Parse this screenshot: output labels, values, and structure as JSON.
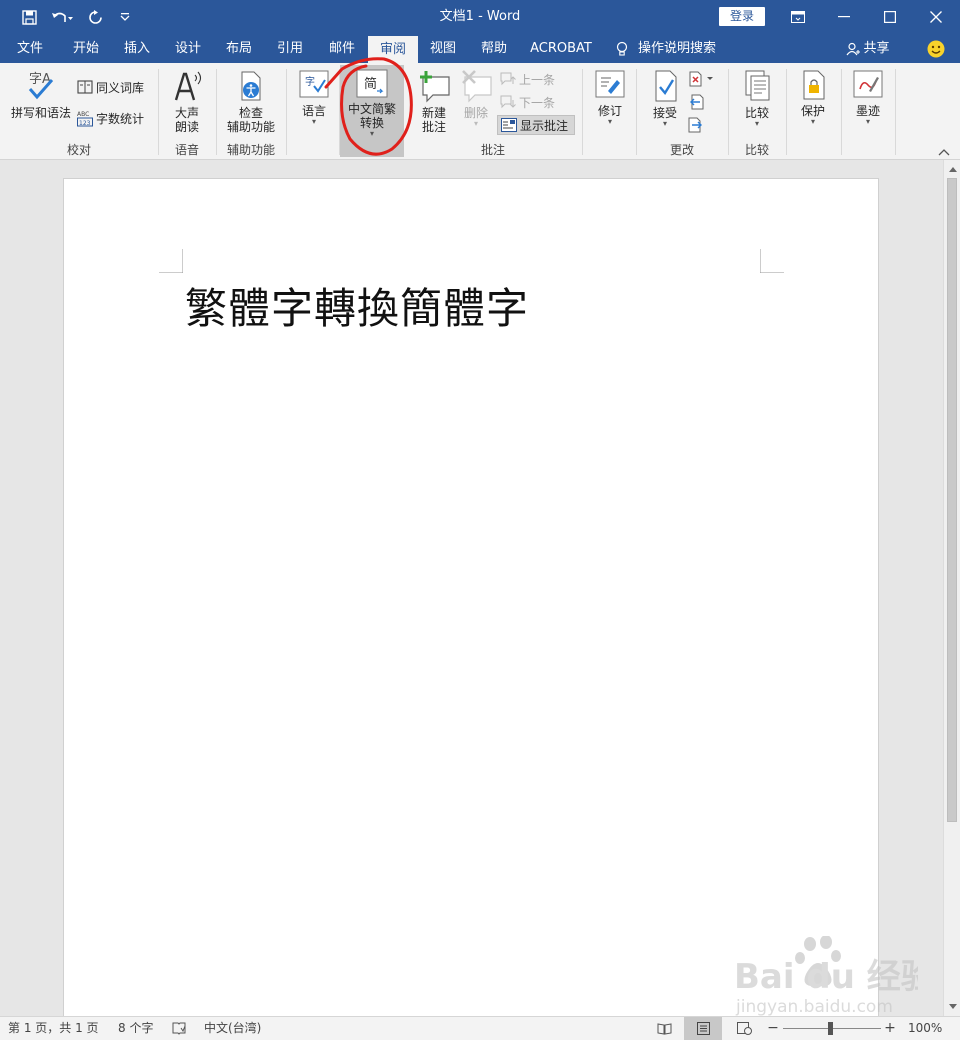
{
  "window": {
    "doc_title": "文档1  -  Word",
    "login_label": "登录"
  },
  "tabs": [
    {
      "label": "文件"
    },
    {
      "label": "开始"
    },
    {
      "label": "插入"
    },
    {
      "label": "设计"
    },
    {
      "label": "布局"
    },
    {
      "label": "引用"
    },
    {
      "label": "邮件"
    },
    {
      "label": "审阅",
      "active": true
    },
    {
      "label": "视图"
    },
    {
      "label": "帮助"
    },
    {
      "label": "ACROBAT"
    },
    {
      "label": "操作说明搜索"
    }
  ],
  "share_label": "共享",
  "ribbon": {
    "proofing": {
      "spelling": "拼写和语法",
      "thesaurus": "同义词库",
      "word_count": "字数统计",
      "group": "校对",
      "spelling_icon_text": "字A",
      "word_count_icon_text": "ABC 123"
    },
    "speech": {
      "read_aloud_1": "大声",
      "read_aloud_2": "朗读",
      "group": "语音"
    },
    "accessibility": {
      "check_1": "检查",
      "check_2": "辅助功能",
      "group": "辅助功能"
    },
    "language": {
      "label": "语言"
    },
    "chinese": {
      "label_1": "中文简繁",
      "label_2": "转换",
      "icon_text": "简"
    },
    "comments": {
      "new_1": "新建",
      "new_2": "批注",
      "delete": "删除",
      "prev": "上一条",
      "next": "下一条",
      "show": "显示批注",
      "group": "批注"
    },
    "tracking": {
      "label": "修订"
    },
    "changes": {
      "accept": "接受",
      "group": "更改"
    },
    "compare": {
      "label": "比较",
      "group": "比较"
    },
    "protect": {
      "label": "保护"
    },
    "ink": {
      "label": "墨迹"
    }
  },
  "document": {
    "text": "繁體字轉換簡體字"
  },
  "status": {
    "page": "第 1 页，共 1 页",
    "words": "8 个字",
    "language": "中文(台湾)",
    "zoom": "100%",
    "zoom_percent": 100
  },
  "watermark": {
    "brand": "Bai du 经验",
    "url": "jingyan.baidu.com"
  },
  "colors": {
    "titlebar": "#2b579a",
    "annotation": "#e0201b"
  }
}
